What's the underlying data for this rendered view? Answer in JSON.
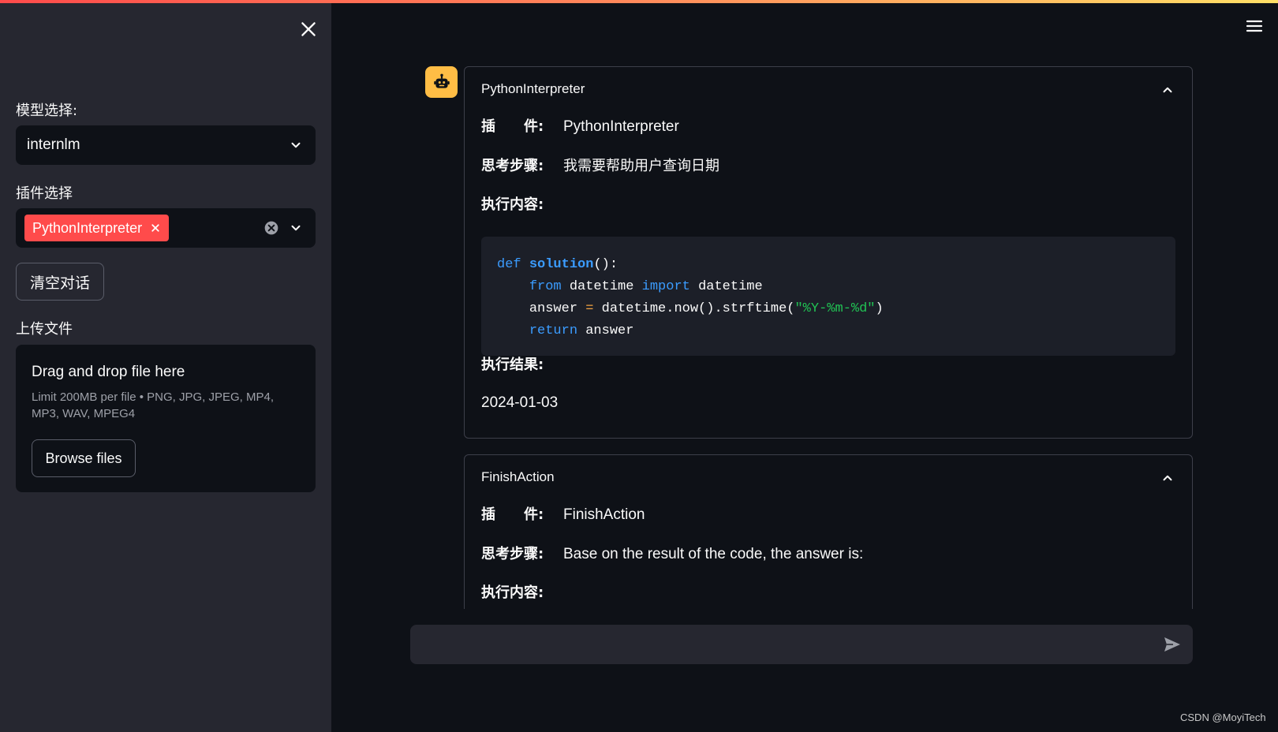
{
  "sidebar": {
    "model_label": "模型选择:",
    "model_value": "internlm",
    "plugin_label": "插件选择",
    "plugin_tag": "PythonInterpreter",
    "clear_button": "清空对话",
    "upload_label": "上传文件",
    "upload_title": "Drag and drop file here",
    "upload_limit": "Limit 200MB per file • PNG, JPG, JPEG, MP4, MP3, WAV, MPEG4",
    "browse_button": "Browse files"
  },
  "chat": {
    "expanders": [
      {
        "title": "PythonInterpreter",
        "plugin_key": "插　　件:",
        "plugin_value": "PythonInterpreter",
        "thought_key": "思考步骤:",
        "thought_value": "我需要帮助用户查询日期",
        "exec_key": "执行内容:",
        "code": {
          "line1_def": "def",
          "line1_name": "solution",
          "line1_rest": "():",
          "line2_from": "from",
          "line2_mod": " datetime ",
          "line2_import": "import",
          "line2_name": " datetime",
          "line3_var": "answer ",
          "line3_eq": "=",
          "line3_call": " datetime.now().strftime(",
          "line3_str": "\"%Y-%m-%d\"",
          "line3_close": ")",
          "line4_return": "return",
          "line4_var": " answer"
        },
        "result_key": "执行结果:",
        "result_value": "2024-01-03"
      },
      {
        "title": "FinishAction",
        "plugin_key": "插　　件:",
        "plugin_value": "FinishAction",
        "thought_key": "思考步骤:",
        "thought_value": "Base on the result of the code, the answer is:",
        "exec_key": "执行内容:"
      }
    ],
    "input_placeholder": ""
  },
  "watermark": "CSDN @MoyiTech",
  "colors": {
    "accent": "#ff4b4b",
    "avatar": "#ffbd45",
    "sidebar_bg": "#262730",
    "main_bg": "#0e1117"
  }
}
